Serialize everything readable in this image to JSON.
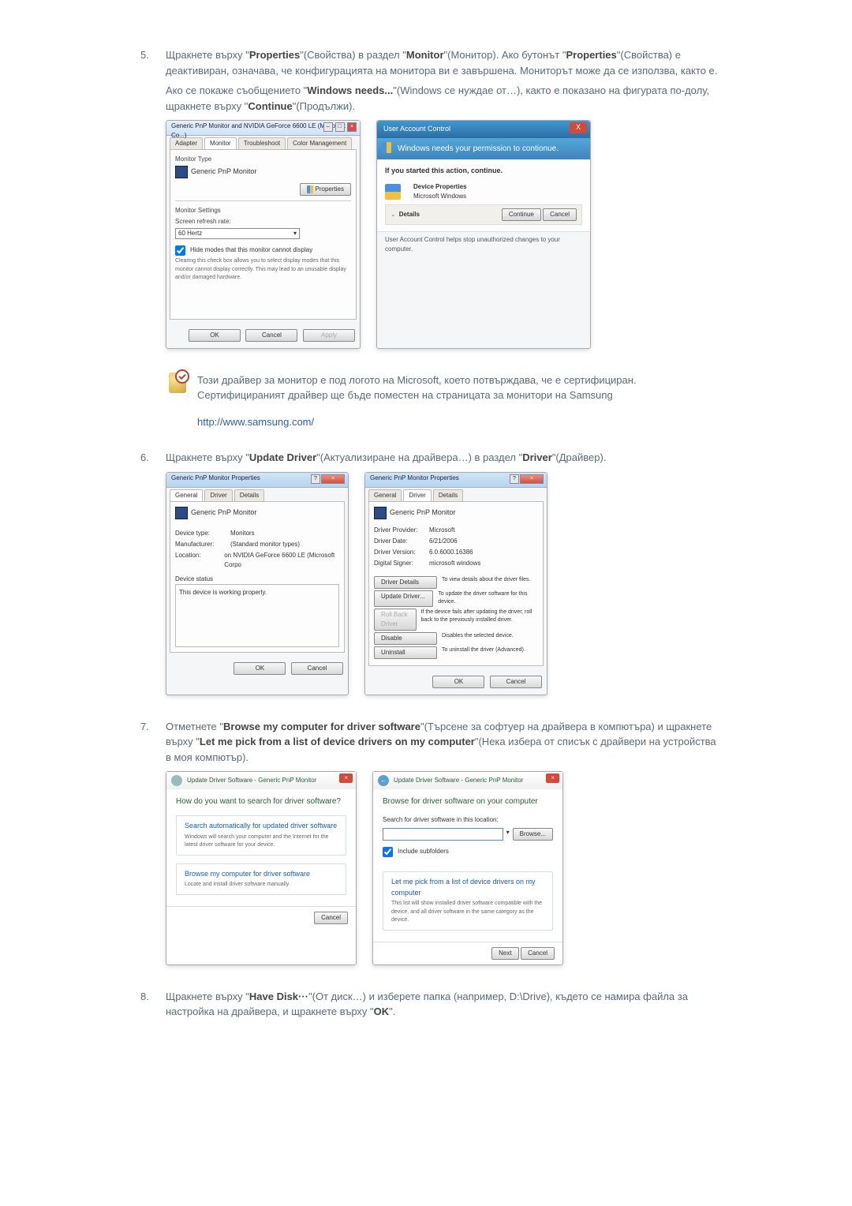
{
  "step5": {
    "num": "5.",
    "sent1_pre": "Щракнете върху \"",
    "sent1_b1": "Properties",
    "sent1_mid1": "\"(Свойства) в раздел \"",
    "sent1_b2": "Monitor",
    "sent1_post1": "\"(Монитор). Ако бутонът \"",
    "sent1_b3": "Properties",
    "sent1_post2": "\"(Свойства) е деактивиран, означава, че конфигурацията на монитора ви е завършена. Мониторът може да се използва, както е.",
    "sent2_pre": "Ако се покаже съобщението \"",
    "sent2_b1": "Windows needs...",
    "sent2_mid": "\"(Windows се нуждае от…), както е показано на фигурата по-долу, щракнете върху \"",
    "sent2_b2": "Continue",
    "sent2_post": "\"(Продължи)."
  },
  "left5": {
    "title": "Generic PnP Monitor and NVIDIA GeForce 6600 LE (Microsoft Co...)",
    "tabs": {
      "adapter": "Adapter",
      "monitor": "Monitor",
      "troubleshoot": "Troubleshoot",
      "color": "Color Management"
    },
    "montype": "Monitor Type",
    "monname": "Generic PnP Monitor",
    "propbtn": "Properties",
    "monset": "Monitor Settings",
    "refreshlbl": "Screen refresh rate:",
    "refreshval": "60 Hertz",
    "hide": "Hide modes that this monitor cannot display",
    "hidehelp": "Clearing this check box allows you to select display modes that this monitor cannot display correctly. This may lead to an unusable display and/or damaged hardware.",
    "ok": "OK",
    "cancel": "Cancel",
    "apply": "Apply"
  },
  "uac": {
    "title": "User Account Control",
    "msg": "Windows needs your permission to contionue.",
    "started": "If you started this action, continue.",
    "devprops": "Device Properties",
    "mswin": "Microsoft Windows",
    "details": "Details",
    "continue": "Continue",
    "cancel": "Cancel",
    "foot": "User Account Control helps stop unauthorized changes to your computer."
  },
  "cert": {
    "line1": "Този драйвер за монитор е под логото на Microsoft, което потвърждава, че е сертифициран.",
    "line2": "Сертифицираният драйвер ще бъде поместен на страницата за монитори на Samsung",
    "url": "http://www.samsung.com/"
  },
  "step6": {
    "num": "6.",
    "pre": "Щракнете върху \"",
    "b1": "Update Driver",
    "mid": "\"(Актуализиране на драйвера…) в раздел \"",
    "b2": "Driver",
    "post": "\"(Драйвер)."
  },
  "p6l": {
    "title": "Generic PnP Monitor Properties",
    "tabs": {
      "general": "General",
      "driver": "Driver",
      "details": "Details"
    },
    "mon": "Generic PnP Monitor",
    "devtype_k": "Device type:",
    "devtype_v": "Monitors",
    "manu_k": "Manufacturer:",
    "manu_v": "(Standard monitor types)",
    "loc_k": "Location:",
    "loc_v": "on NVIDIA GeForce 6600 LE (Microsoft Corpo",
    "status_h": "Device status",
    "status_v": "This device is working properly.",
    "ok": "OK",
    "cancel": "Cancel"
  },
  "p6r": {
    "title": "Generic PnP Monitor Properties",
    "tabs": {
      "general": "General",
      "driver": "Driver",
      "details": "Details"
    },
    "mon": "Generic PnP Monitor",
    "prov_k": "Driver Provider:",
    "prov_v": "Microsoft",
    "date_k": "Driver Date:",
    "date_v": "6/21/2006",
    "ver_k": "Driver Version:",
    "ver_v": "6.0.6000.16386",
    "sign_k": "Digital Signer:",
    "sign_v": "microsoft windows",
    "btn_details": "Driver Details",
    "btn_details_d": "To view details about the driver files.",
    "btn_update": "Update Driver...",
    "btn_update_d": "To update the driver software for this device.",
    "btn_roll": "Roll Back Driver",
    "btn_roll_d": "If the device fails after updating the driver, roll back to the previously installed driver.",
    "btn_disable": "Disable",
    "btn_disable_d": "Disables the selected device.",
    "btn_uninstall": "Uninstall",
    "btn_uninstall_d": "To uninstall the driver (Advanced).",
    "ok": "OK",
    "cancel": "Cancel"
  },
  "step7": {
    "num": "7.",
    "pre": "Отметнете \"",
    "b1": "Browse my computer for driver software",
    "mid1": "\"(Търсене за софтуер на драйвера в компютъра) и щракнете върху \"",
    "b2": "Let me pick from a list of device drivers on my computer",
    "post": "\"(Нека избера от списък с драйвери на устройства в моя компютър)."
  },
  "wizL": {
    "crumb": "Update Driver Software - Generic PnP Monitor",
    "h": "How do you want to search for driver software?",
    "o1t": "Search automatically for updated driver software",
    "o1d": "Windows will search your computer and the Internet for the latest driver software for your device.",
    "o2t": "Browse my computer for driver software",
    "o2d": "Locate and install driver software manually.",
    "cancel": "Cancel"
  },
  "wizR": {
    "crumb": "Update Driver Software - Generic PnP Monitor",
    "h": "Browse for driver software on your computer",
    "lbl": "Search for driver software in this location:",
    "browse": "Browse...",
    "sub": "Include subfolders",
    "o1t": "Let me pick from a list of device drivers on my computer",
    "o1d": "This list will show installed driver software compatible with the device, and all driver software in the same category as the device.",
    "next": "Next",
    "cancel": "Cancel"
  },
  "step8": {
    "num": "8.",
    "pre": "Щракнете върху \"",
    "b1": "Have Disk···",
    "mid": "\"(От диск…) и изберете папка (например, D:\\Drive), където се намира файла за настройка на драйвера, и щракнете върху \"",
    "b2": "OK",
    "post": "\"."
  }
}
